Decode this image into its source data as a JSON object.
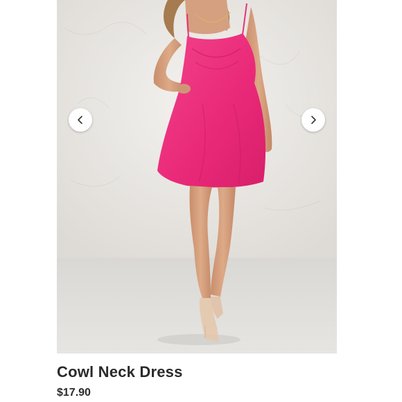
{
  "product": {
    "title": "Cowl Neck Dress",
    "price": "$17.90"
  },
  "carousel": {
    "prev_icon": "chevron-left-icon",
    "next_icon": "chevron-right-icon"
  },
  "colors": {
    "dress": "#ee2f7e",
    "wall": "#ebe8e3",
    "floor": "#dcdbd8",
    "text": "#2b2b2b"
  }
}
